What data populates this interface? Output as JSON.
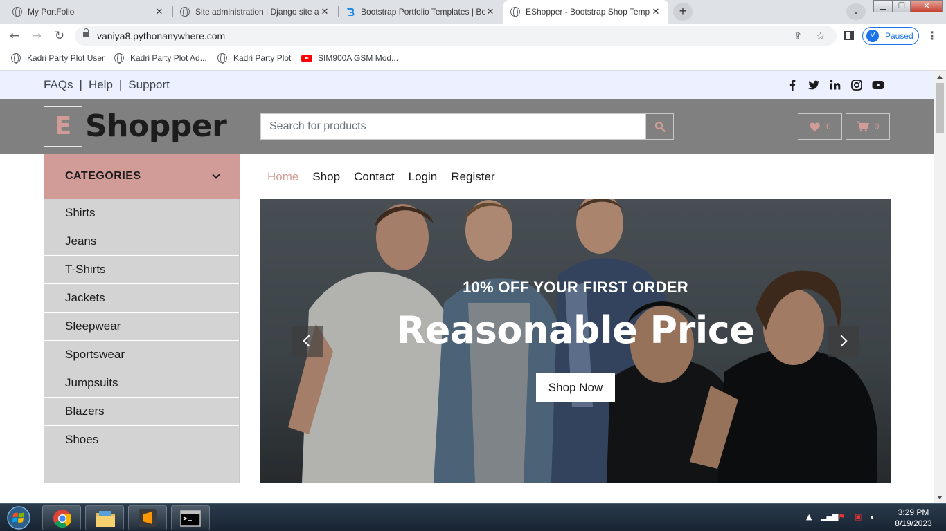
{
  "browser": {
    "tabs": [
      {
        "title": "My PortFolio",
        "icon": "globe-icon"
      },
      {
        "title": "Site administration | Django site a",
        "icon": "globe-icon"
      },
      {
        "title": "Bootstrap Portfolio Templates | Bo",
        "icon": "bootstrapmade-icon"
      },
      {
        "title": "EShopper - Bootstrap Shop Temp",
        "icon": "globe-icon",
        "active": true
      }
    ],
    "url": "vaniya8.pythonanywhere.com",
    "profile_initial": "V",
    "profile_status": "Paused",
    "bookmarks": [
      {
        "label": "Kadri Party Plot User",
        "icon": "globe-icon"
      },
      {
        "label": "Kadri Party Plot Ad...",
        "icon": "globe-icon"
      },
      {
        "label": "Kadri Party Plot",
        "icon": "globe-icon"
      },
      {
        "label": "SIM900A GSM Mod...",
        "icon": "youtube-icon"
      }
    ]
  },
  "site": {
    "top_links": [
      "FAQs",
      "Help",
      "Support"
    ],
    "social_icons": [
      "facebook-icon",
      "twitter-icon",
      "linkedin-icon",
      "instagram-icon",
      "youtube-icon"
    ],
    "logo_letter": "E",
    "logo_text": "Shopper",
    "search_placeholder": "Search for products",
    "wishlist_count": "0",
    "cart_count": "0",
    "categories_label": "CATEGORIES",
    "categories": [
      "Shirts",
      "Jeans",
      "T-Shirts",
      "Jackets",
      "Sleepwear",
      "Sportswear",
      "Jumpsuits",
      "Blazers",
      "Shoes"
    ],
    "nav": [
      "Home",
      "Shop",
      "Contact",
      "Login",
      "Register"
    ],
    "active_nav": "Home",
    "hero": {
      "subtitle": "10% OFF YOUR FIRST ORDER",
      "title": "Reasonable Price",
      "button": "Shop Now"
    },
    "accent_color": "#d19c97"
  },
  "taskbar": {
    "time": "3:29 PM",
    "date": "8/19/2023"
  }
}
